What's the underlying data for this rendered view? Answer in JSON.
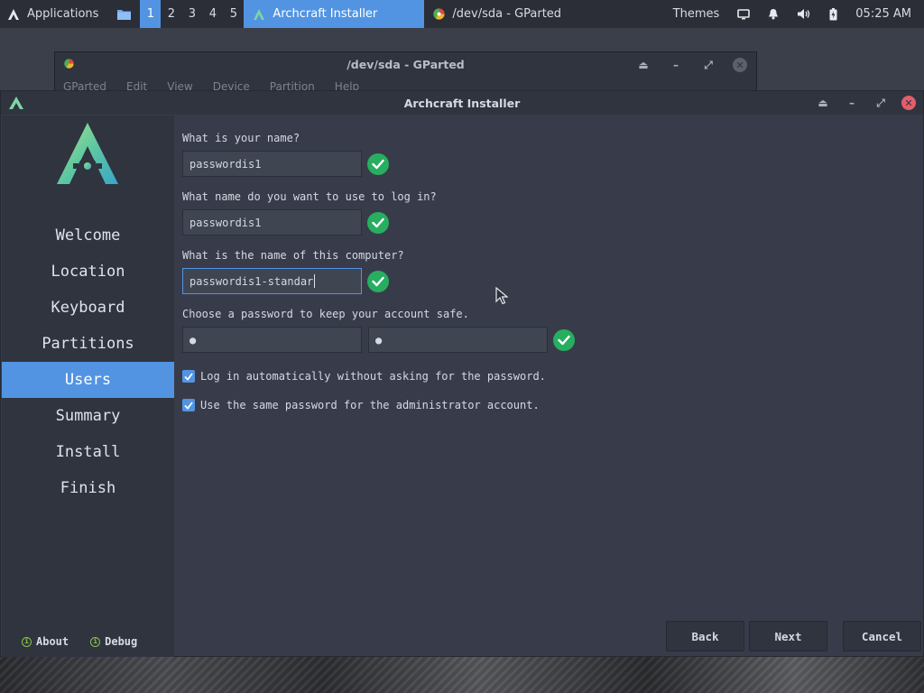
{
  "panel": {
    "applications_label": "Applications",
    "workspaces": [
      "1",
      "2",
      "3",
      "4",
      "5"
    ],
    "active_workspace": "1",
    "tasks": [
      {
        "label": "Archcraft Installer",
        "active": true,
        "icon": "archcraft-logo-icon"
      },
      {
        "label": "/dev/sda - GParted",
        "active": false,
        "icon": "gparted-icon"
      }
    ],
    "themes_label": "Themes",
    "clock": "05:25 AM"
  },
  "gparted": {
    "title": "/dev/sda - GParted",
    "menu": [
      "GParted",
      "Edit",
      "View",
      "Device",
      "Partition",
      "Help"
    ]
  },
  "installer": {
    "title": "Archcraft Installer",
    "nav": [
      {
        "label": "Welcome",
        "active": false
      },
      {
        "label": "Location",
        "active": false
      },
      {
        "label": "Keyboard",
        "active": false
      },
      {
        "label": "Partitions",
        "active": false
      },
      {
        "label": "Users",
        "active": true
      },
      {
        "label": "Summary",
        "active": false
      },
      {
        "label": "Install",
        "active": false
      },
      {
        "label": "Finish",
        "active": false
      }
    ],
    "about_label": "About",
    "debug_label": "Debug",
    "form": {
      "name_question": "What is your name?",
      "name_value": "passwordis1",
      "login_question": "What name do you want to use to log in?",
      "login_value": "passwordis1",
      "computer_question": "What is the name of this computer?",
      "computer_value": "passwordis1-standar",
      "password_question": "Choose a password to keep your account safe.",
      "password_value": "●",
      "password_confirm_value": "●",
      "autologin_label": "Log in automatically without asking for the password.",
      "autologin_checked": true,
      "same_password_label": "Use the same password for the administrator account.",
      "same_password_checked": true
    },
    "buttons": {
      "back": "Back",
      "next": "Next",
      "cancel": "Cancel"
    },
    "colors": {
      "accent": "#5294e2",
      "valid": "#27ae60",
      "sidebar_bg": "#2f343f",
      "window_bg": "#383c4a"
    }
  }
}
